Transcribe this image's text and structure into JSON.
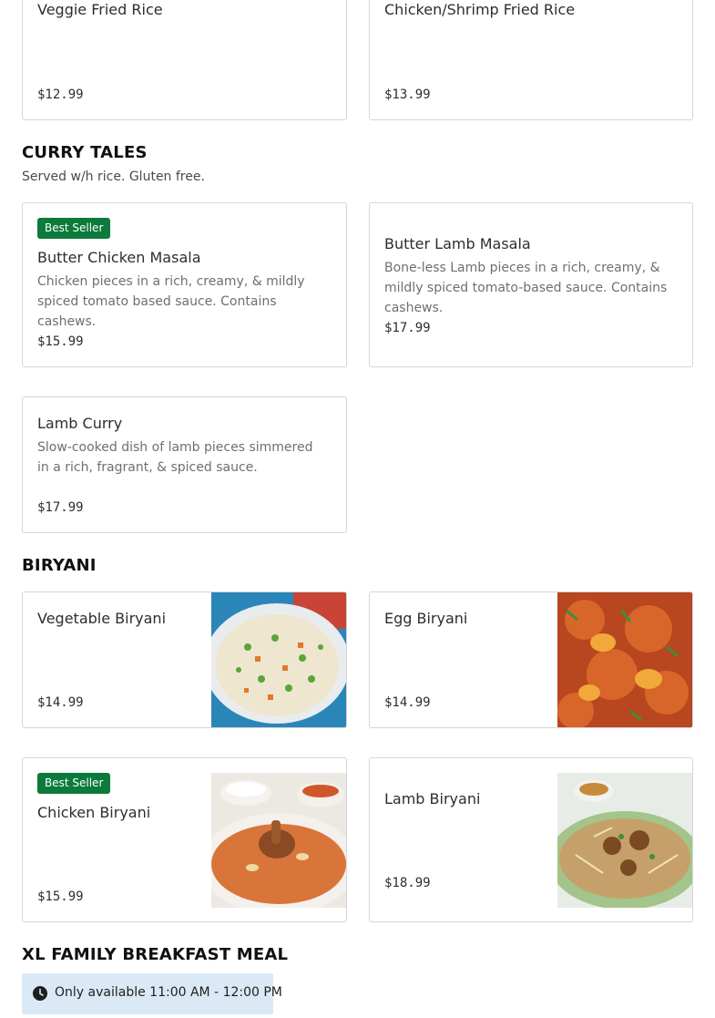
{
  "fried_rice_items": [
    {
      "name": "Veggie Fried Rice",
      "price": "$12.99"
    },
    {
      "name": "Chicken/Shrimp Fried Rice",
      "price": "$13.99"
    }
  ],
  "curry_tales": {
    "title": "CURRY TALES",
    "subtitle": "Served w/h rice. Gluten free.",
    "items": [
      {
        "badge": "Best Seller",
        "name": "Butter Chicken Masala",
        "description": "Chicken pieces in a rich, creamy, & mildly spiced tomato based sauce. Contains cashews.",
        "price": "$15.99"
      },
      {
        "name": "Butter Lamb Masala",
        "description": "Bone-less Lamb pieces in a rich, creamy, & mildly spiced tomato-based sauce. Contains cashews.",
        "price": "$17.99"
      },
      {
        "name": "Lamb Curry",
        "description": "Slow-cooked dish of lamb pieces simmered in a rich, fragrant, & spiced sauce.",
        "price": "$17.99"
      }
    ]
  },
  "biryani": {
    "title": "BIRYANI",
    "items": [
      {
        "name": "Vegetable Biryani",
        "price": "$14.99",
        "image": "vegetable-biryani-photo"
      },
      {
        "name": "Egg Biryani",
        "price": "$14.99",
        "image": "egg-biryani-photo"
      },
      {
        "badge": "Best Seller",
        "name": "Chicken Biryani",
        "price": "$15.99",
        "image": "chicken-biryani-photo"
      },
      {
        "name": "Lamb Biryani",
        "price": "$18.99",
        "image": "lamb-biryani-photo"
      }
    ]
  },
  "family_meal": {
    "title": "XL FAMILY BREAKFAST MEAL",
    "availability": "Only available 11:00 AM - 12:00 PM",
    "icon": "clock-icon"
  },
  "colors": {
    "badge_bg": "#0b7a3b",
    "availability_bg": "#dbe9f6",
    "card_border": "#d6d6d6"
  }
}
